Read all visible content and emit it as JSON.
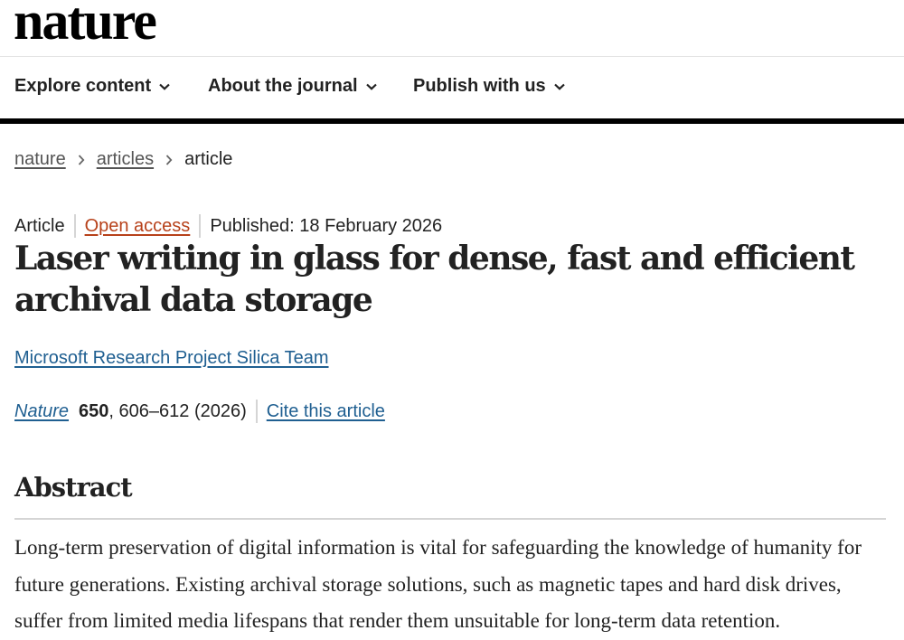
{
  "logo": {
    "text": "nature"
  },
  "nav": {
    "items": [
      {
        "label": "Explore content"
      },
      {
        "label": "About the journal"
      },
      {
        "label": "Publish with us"
      }
    ]
  },
  "breadcrumb": {
    "items": [
      "nature",
      "articles",
      "article"
    ]
  },
  "article": {
    "type": "Article",
    "access": "Open access",
    "published": "Published: 18 February 2026",
    "title": "Laser writing in glass for dense, fast and efficient archival data storage",
    "author": "Microsoft Research Project Silica Team",
    "citation": {
      "journal": "Nature",
      "volume": "650",
      "pages_year": ", 606–612 (2026)",
      "cite_label": "Cite this article"
    }
  },
  "abstract": {
    "heading": "Abstract",
    "text": "Long-term preservation of digital information is vital for safeguarding the knowledge of humanity for future generations. Existing archival storage solutions, such as magnetic tapes and hard disk drives, suffer from limited media lifespans that render them unsuitable for long-term data retention."
  },
  "colors": {
    "link": "#1f5f91",
    "open_access": "#b7411a",
    "text": "#222222",
    "nav_border": "#000000"
  }
}
